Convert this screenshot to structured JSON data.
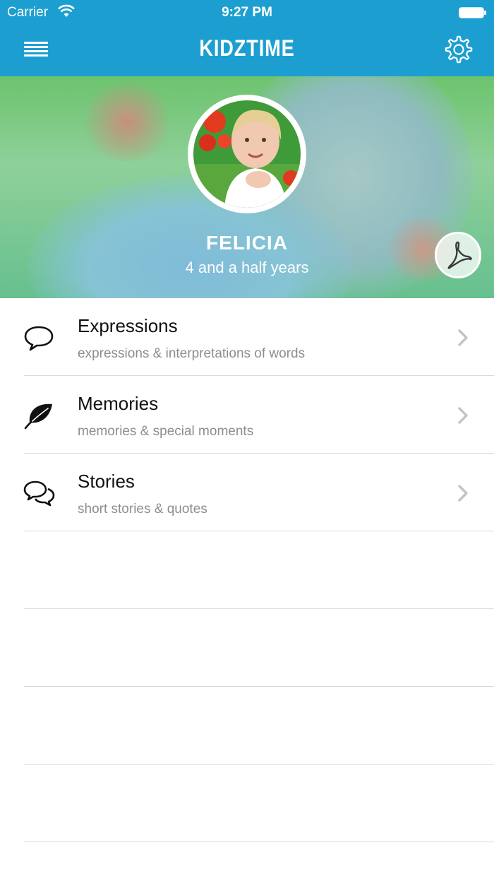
{
  "status_bar": {
    "carrier": "Carrier",
    "time": "9:27 PM"
  },
  "nav": {
    "title": "KIDZTIME",
    "menu_icon": "hamburger-menu-icon",
    "settings_icon": "gear-icon"
  },
  "profile": {
    "name": "FELICIA",
    "age": "4 and a half years",
    "pdf_icon": "pdf-icon"
  },
  "categories": [
    {
      "title": "Expressions",
      "subtitle": "expressions & interpretations of words",
      "icon": "speech-bubble-icon"
    },
    {
      "title": "Memories",
      "subtitle": "memories & special moments",
      "icon": "leaf-icon"
    },
    {
      "title": "Stories",
      "subtitle": "short stories & quotes",
      "icon": "chat-bubbles-icon"
    }
  ],
  "colors": {
    "accent": "#1c9fd0",
    "separator": "#d9d9d9",
    "subtitle_text": "#8d8d8d"
  }
}
